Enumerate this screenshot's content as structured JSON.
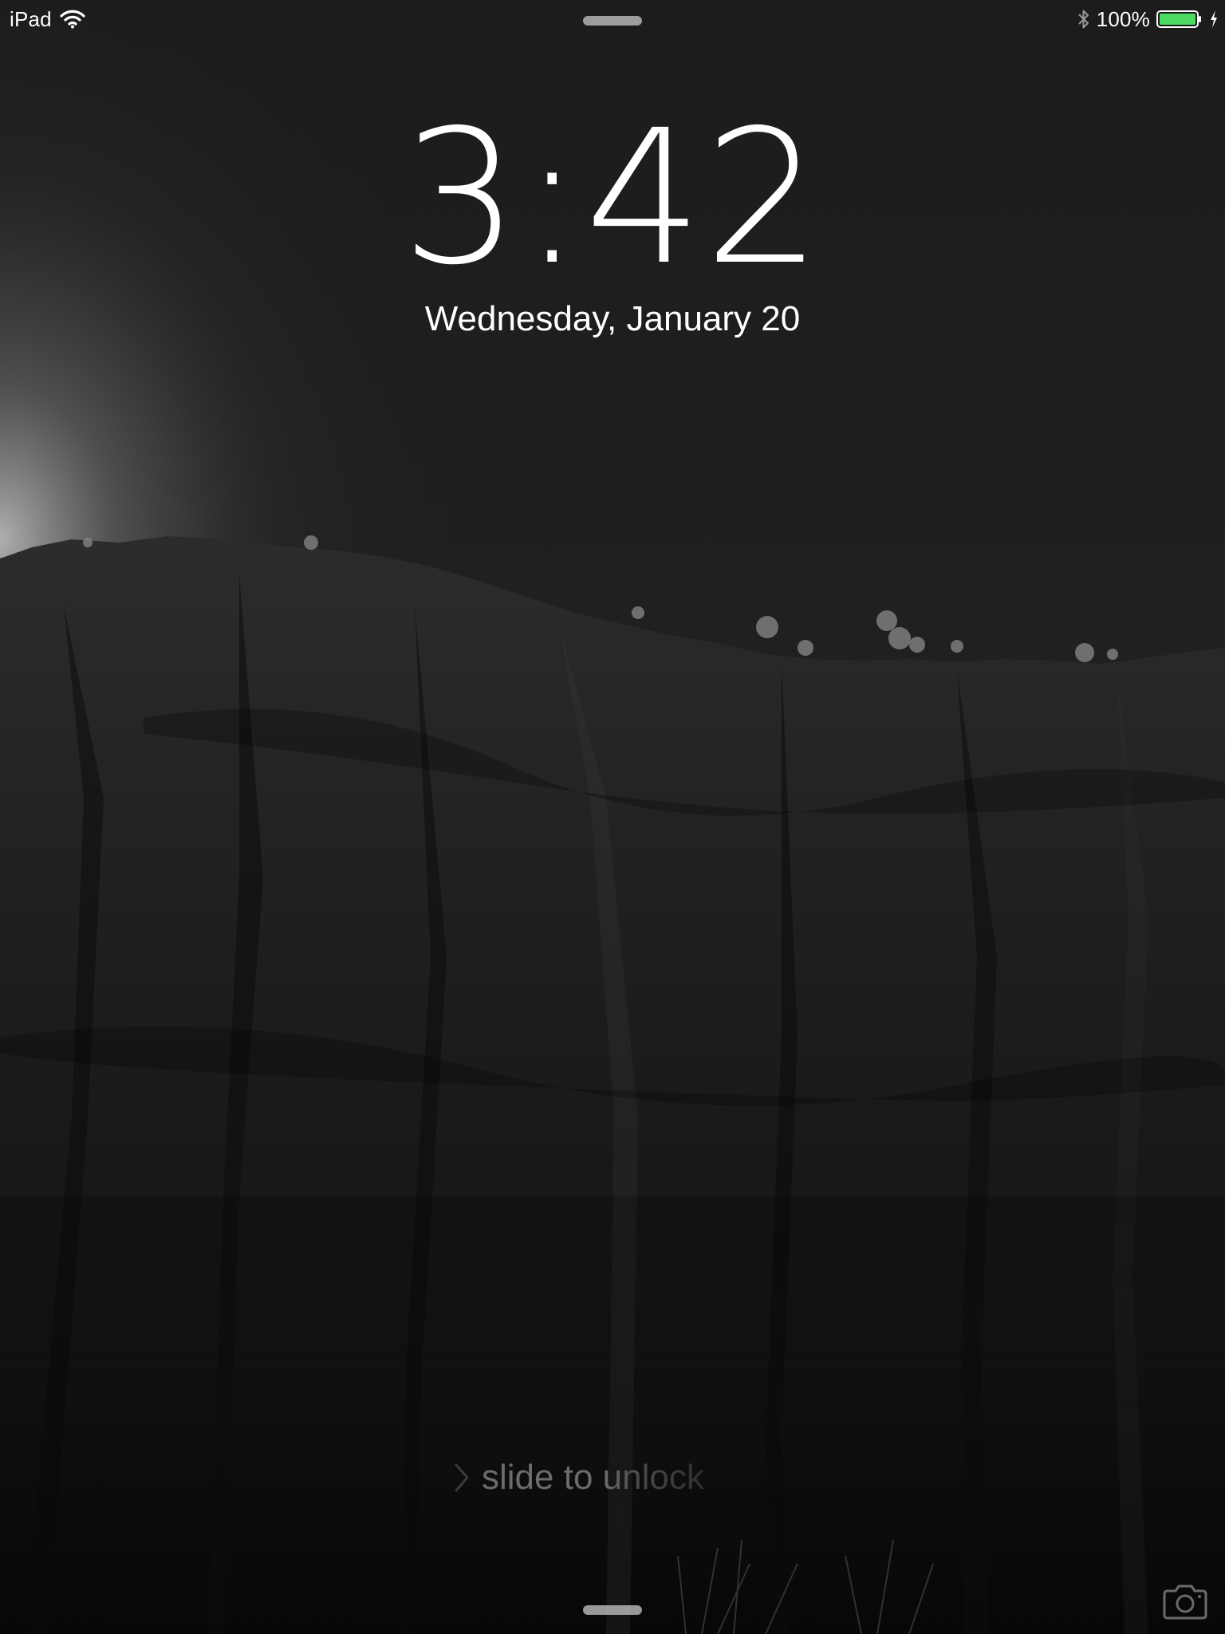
{
  "status_bar": {
    "device": "iPad",
    "battery_percent_text": "100%",
    "battery_level": 1.0,
    "battery_color": "#4cd964",
    "icons": [
      "wifi-icon",
      "bluetooth-icon",
      "battery-icon",
      "charging-bolt-icon"
    ]
  },
  "lock_screen": {
    "time": "3:42",
    "date": "Wednesday, January 20",
    "unlock_hint": "slide to unlock",
    "icons": [
      "slide-chevron-icon",
      "camera-icon"
    ]
  }
}
